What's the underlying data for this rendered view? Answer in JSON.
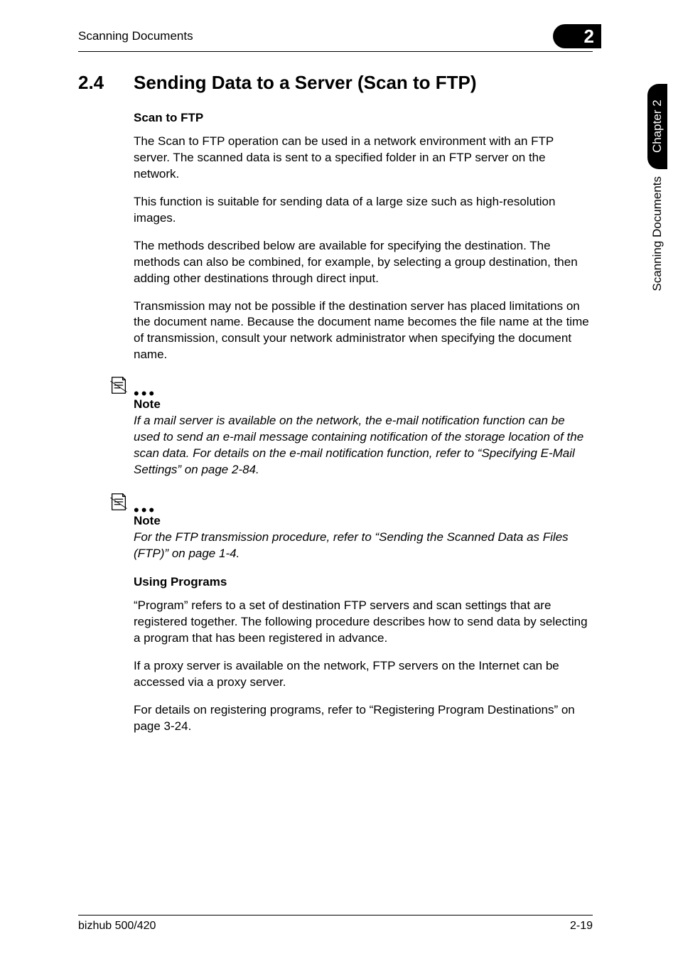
{
  "header": {
    "running_title": "Scanning Documents",
    "chapter_badge": "2"
  },
  "side_tab": {
    "black": "Chapter 2",
    "white": "Scanning Documents"
  },
  "section": {
    "number": "2.4",
    "title": "Sending Data to a Server (Scan to FTP)"
  },
  "sub1": {
    "heading": "Scan to FTP",
    "p1": "The Scan to FTP operation can be used in a network environment with an FTP server. The scanned data is sent to a specified folder in an FTP server on the network.",
    "p2": "This function is suitable for sending data of a large size such as high-resolution images.",
    "p3": "The methods described below are available for specifying the destination. The methods can also be combined, for example, by selecting a group destination, then adding other destinations through direct input.",
    "p4": "Transmission may not be possible if the destination server has placed limitations on the document name. Because the document name becomes the file name at the time of transmission, consult your network administrator when specifying the document name."
  },
  "note1": {
    "label": "Note",
    "text": "If a mail server is available on the network, the e-mail notification function can be used to send an e-mail message containing notification of the storage location of the scan data. For details on the e-mail notification function, refer to “Specifying E-Mail Settings” on page 2-84."
  },
  "note2": {
    "label": "Note",
    "text": "For the FTP transmission procedure, refer to “Sending the Scanned Data as Files (FTP)” on page 1-4."
  },
  "sub2": {
    "heading": "Using Programs",
    "p1": "“Program” refers to a set of destination FTP servers and scan settings that are registered together. The following procedure describes how to send data by selecting a program that has been registered in advance.",
    "p2": "If a proxy server is available on the network, FTP servers on the Internet can be accessed via a proxy server.",
    "p3": "For details on registering programs, refer to “Registering Program Destinations” on page 3-24."
  },
  "footer": {
    "left": "bizhub 500/420",
    "right": "2-19"
  }
}
